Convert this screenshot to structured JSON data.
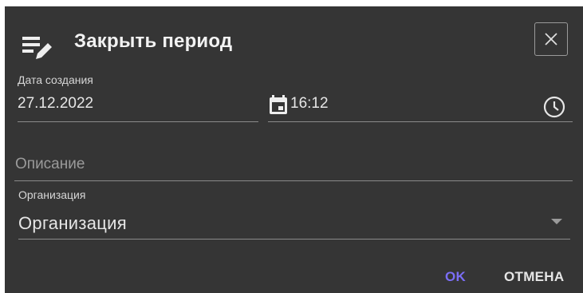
{
  "dialog": {
    "title": "Закрыть период",
    "header_icon": "edit-list-icon",
    "close_icon": "close-icon"
  },
  "date_field": {
    "label": "Дата создания",
    "value": "27.12.2022",
    "icon": "calendar-icon"
  },
  "time_field": {
    "value": "16:12",
    "icon": "clock-icon"
  },
  "description_field": {
    "placeholder": "Описание",
    "value": ""
  },
  "organization_field": {
    "label": "Организация",
    "value": "Организация",
    "icon": "dropdown-arrow-icon"
  },
  "actions": {
    "ok_label": "OK",
    "cancel_label": "ОТМЕНА"
  },
  "colors": {
    "dialog_background": "#353535",
    "ok_accent": "#7b6ef6",
    "text": "#e6e6e6",
    "divider": "#8a8a8a"
  }
}
